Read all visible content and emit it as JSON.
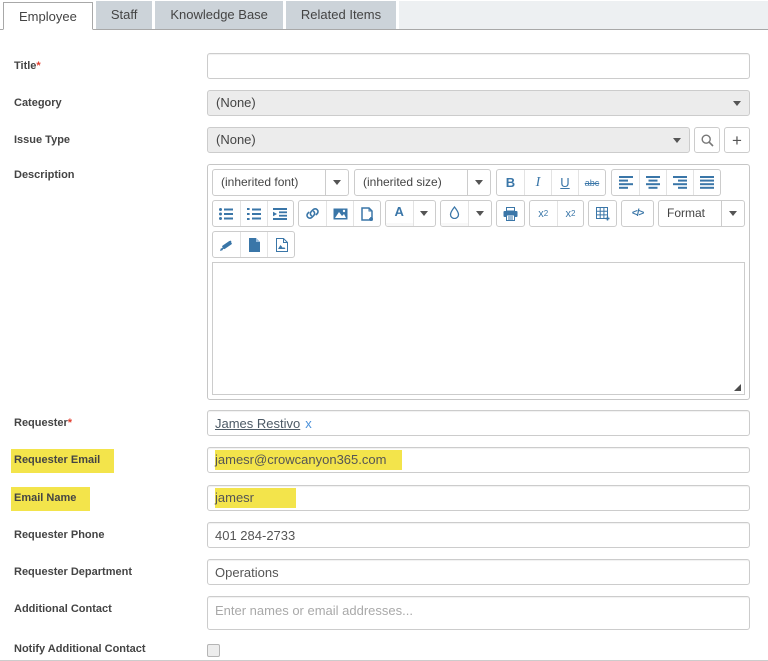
{
  "tabs": [
    {
      "label": "Employee",
      "active": true
    },
    {
      "label": "Staff",
      "active": false
    },
    {
      "label": "Knowledge Base",
      "active": false
    },
    {
      "label": "Related Items",
      "active": false
    }
  ],
  "form": {
    "title": {
      "label": "Title",
      "required_marker": "*",
      "value": ""
    },
    "category": {
      "label": "Category",
      "value": "(None)"
    },
    "issue_type": {
      "label": "Issue Type",
      "value": "(None)"
    },
    "description": {
      "label": "Description",
      "toolbar": {
        "font_dropdown": "(inherited font)",
        "size_dropdown": "(inherited size)",
        "format_dropdown": "Format",
        "glyphs": {
          "bold": "B",
          "italic": "I",
          "underline": "U",
          "strikethrough": "abc",
          "font_color": "A",
          "script_base": "x",
          "script_index": "2",
          "source_code": "</>"
        },
        "icons": [
          "align-left",
          "align-center",
          "align-right",
          "align-justify",
          "bullet-list",
          "numbered-list",
          "indent",
          "link",
          "image",
          "page-break-plus",
          "font-color",
          "highlight-color",
          "print",
          "subscript",
          "superscript",
          "table-plus",
          "source-code",
          "format-brush",
          "new-document",
          "image-file"
        ]
      },
      "content": ""
    },
    "requester": {
      "label": "Requester",
      "required_marker": "*",
      "value": "James Restivo",
      "remove_label": "x"
    },
    "requester_email": {
      "label": "Requester Email",
      "value": "jamesr@crowcanyon365.com",
      "highlighted": true
    },
    "email_name": {
      "label": "Email Name",
      "value": "jamesr",
      "highlighted": true
    },
    "requester_phone": {
      "label": "Requester Phone",
      "value": "401 284-2733"
    },
    "requester_department": {
      "label": "Requester Department",
      "value": "Operations"
    },
    "additional_contact": {
      "label": "Additional Contact",
      "placeholder": "Enter names or email addresses..."
    },
    "notify_additional_contact": {
      "label": "Notify Additional Contact",
      "checked": false
    }
  },
  "colors": {
    "highlight_yellow": "#f3e44b",
    "toolbar_icon_blue": "#3a76a8",
    "link_blue": "#4a90d9",
    "required_red": "#e23d2e",
    "inactive_tab_gray": "#ccd3d9"
  }
}
